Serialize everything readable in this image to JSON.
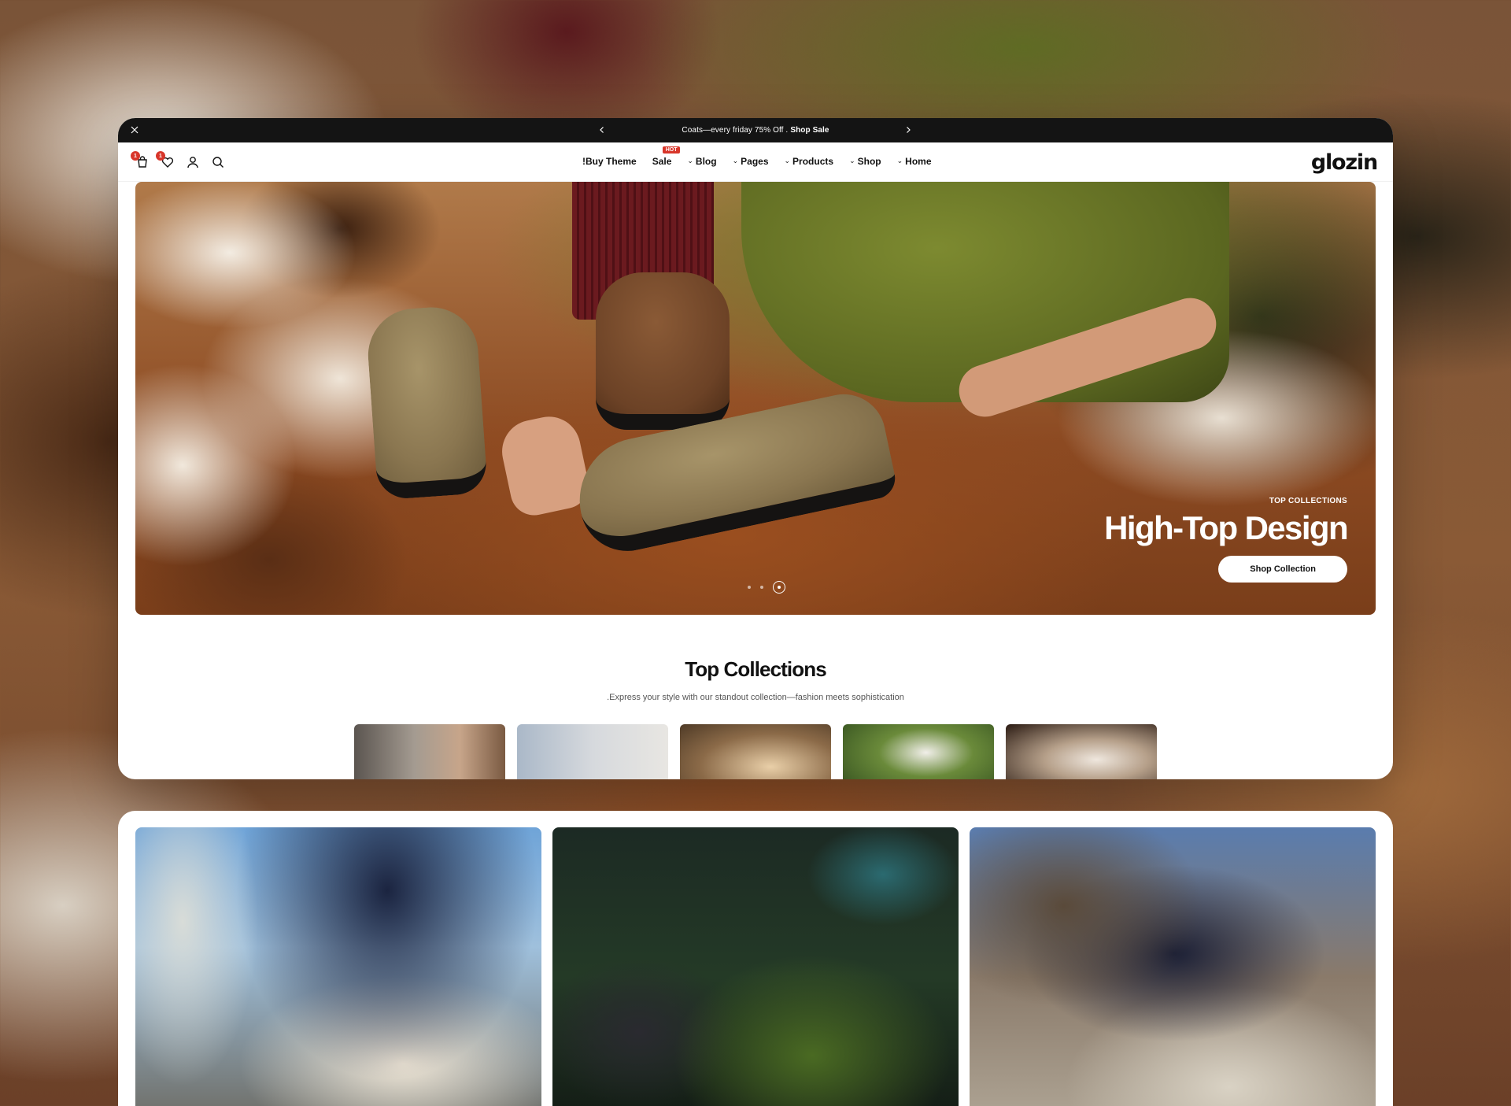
{
  "announcement": {
    "text": "Coats—every friday 75% Off .",
    "link": "Shop Sale"
  },
  "header": {
    "logo": "glozin",
    "cart_count": "1",
    "wishlist_count": "1",
    "menu": [
      {
        "label": "!Buy Theme",
        "has_dropdown": false
      },
      {
        "label": "Sale",
        "badge": "HOT",
        "has_dropdown": false
      },
      {
        "label": "Blog",
        "has_dropdown": true
      },
      {
        "label": "Pages",
        "has_dropdown": true
      },
      {
        "label": "Products",
        "has_dropdown": true
      },
      {
        "label": "Shop",
        "has_dropdown": true
      },
      {
        "label": "Home",
        "has_dropdown": true
      }
    ]
  },
  "hero": {
    "eyebrow": "TOP COLLECTIONS",
    "title": "High-Top Design",
    "button": "Shop Collection",
    "slides": 3,
    "active_slide": 3
  },
  "collections": {
    "title": "Top Collections",
    "subtitle": ".Express your style with our standout collection—fashion meets sophistication",
    "thumb_count": 5
  },
  "colors": {
    "accent": "#d8362a",
    "announce_bg": "#141414",
    "text": "#111111"
  },
  "icons": [
    "close-icon",
    "chevron-left-icon",
    "chevron-right-icon",
    "cart-icon",
    "heart-icon",
    "user-icon",
    "search-icon",
    "chevron-down-icon"
  ]
}
